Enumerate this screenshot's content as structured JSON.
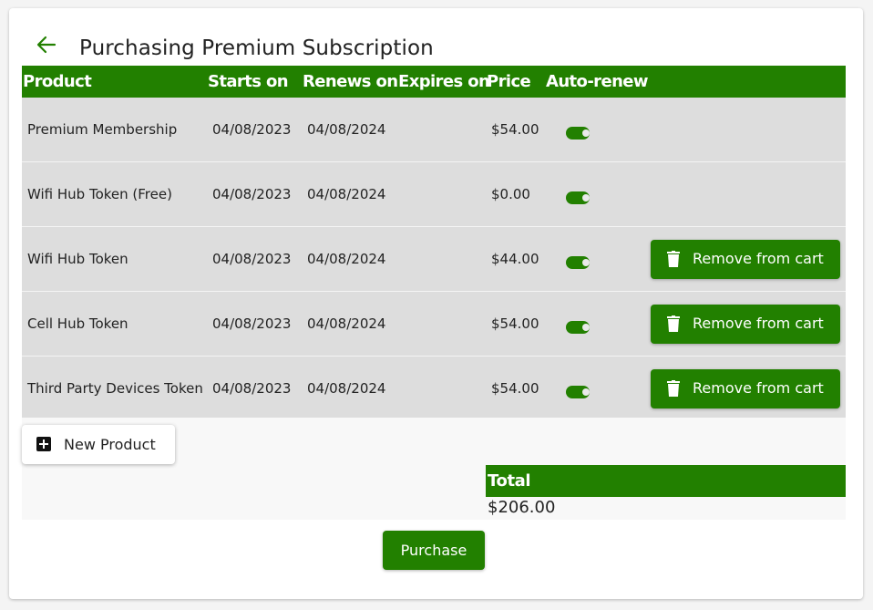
{
  "header": {
    "title": "Purchasing Premium Subscription",
    "back_icon": "arrow-left-icon"
  },
  "table": {
    "columns": {
      "product": "Product",
      "starts_on": "Starts on",
      "renews_on": "Renews on",
      "expires_on": "Expires on",
      "price": "Price",
      "auto_renew": "Auto-renew"
    },
    "rows": [
      {
        "product": "Premium Membership",
        "starts_on": "04/08/2023",
        "renews_on": "04/08/2024",
        "expires_on": "",
        "price": "$54.00",
        "auto_renew": true,
        "removable": false
      },
      {
        "product": "Wifi Hub Token (Free)",
        "starts_on": "04/08/2023",
        "renews_on": "04/08/2024",
        "expires_on": "",
        "price": "$0.00",
        "auto_renew": true,
        "removable": false
      },
      {
        "product": "Wifi Hub Token",
        "starts_on": "04/08/2023",
        "renews_on": "04/08/2024",
        "expires_on": "",
        "price": "$44.00",
        "auto_renew": true,
        "removable": true
      },
      {
        "product": "Cell Hub Token",
        "starts_on": "04/08/2023",
        "renews_on": "04/08/2024",
        "expires_on": "",
        "price": "$54.00",
        "auto_renew": true,
        "removable": true
      },
      {
        "product": "Third Party Devices Token",
        "starts_on": "04/08/2023",
        "renews_on": "04/08/2024",
        "expires_on": "",
        "price": "$54.00",
        "auto_renew": true,
        "removable": true
      }
    ],
    "remove_label": "Remove from cart",
    "remove_icon": "trash-icon"
  },
  "actions": {
    "new_product_label": "New Product",
    "new_product_icon": "plus-square-icon",
    "purchase_label": "Purchase"
  },
  "total": {
    "label": "Total",
    "value": "$206.00"
  },
  "colors": {
    "accent": "#228000",
    "row_bg": "#dddddd"
  }
}
